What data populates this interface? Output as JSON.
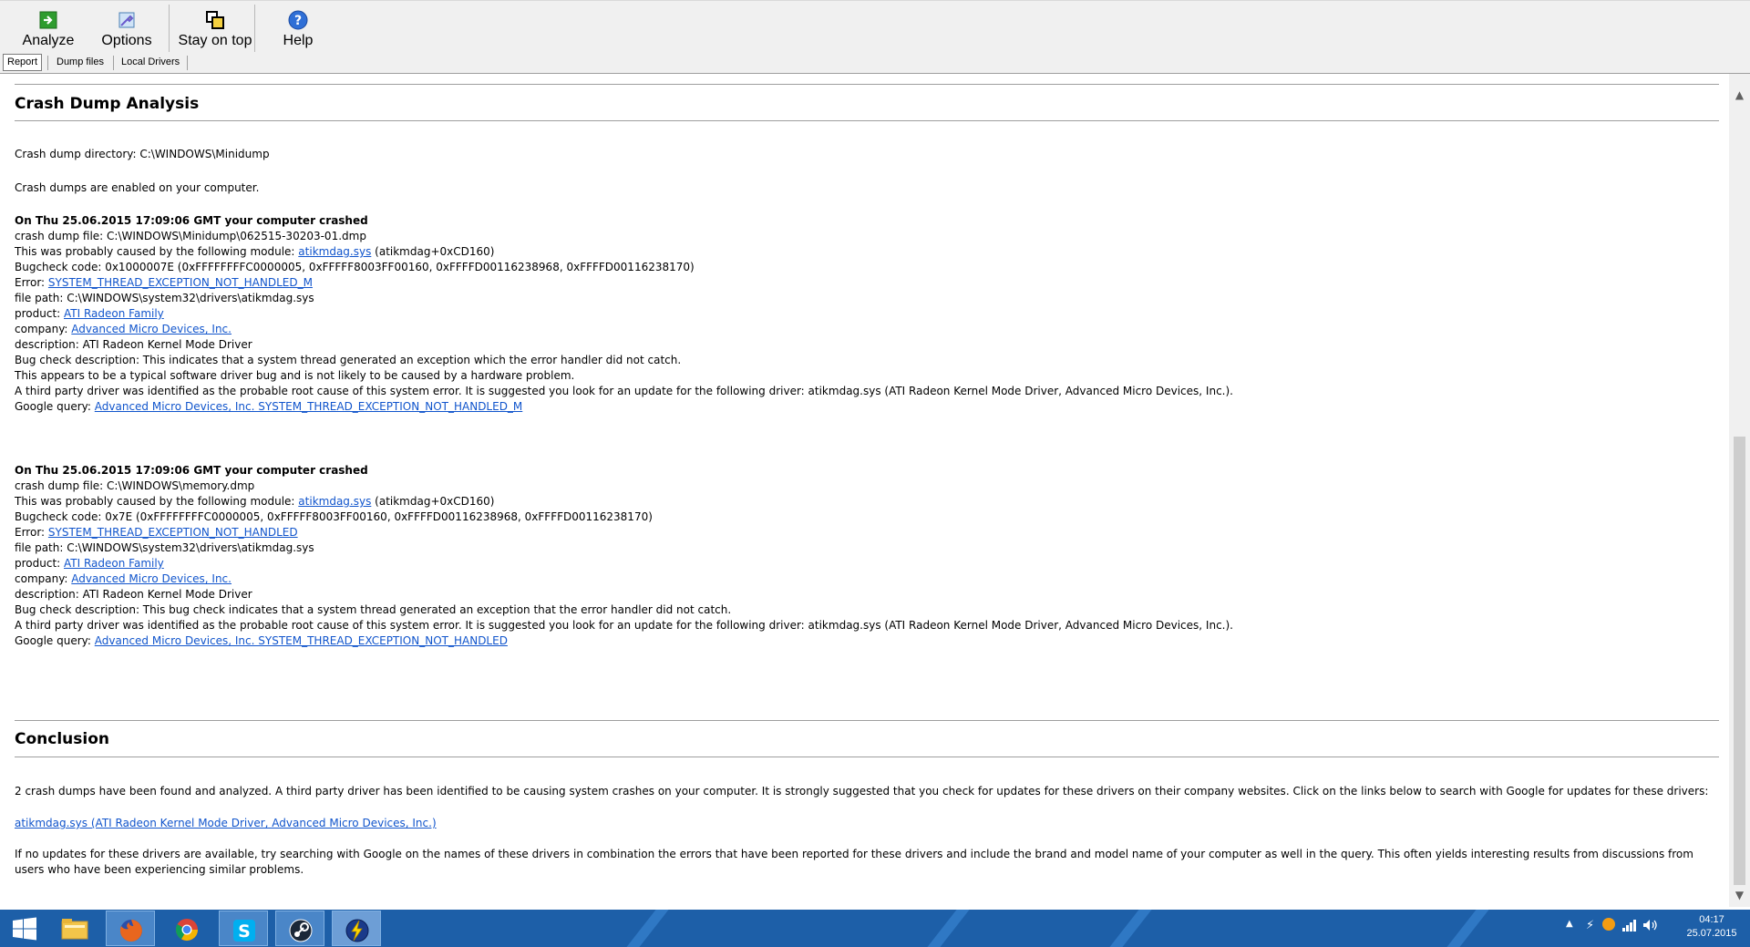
{
  "toolbar": {
    "analyze": "Analyze",
    "options": "Options",
    "stay_on_top": "Stay on top",
    "help": "Help"
  },
  "tabs": [
    "Report",
    "Dump files",
    "Local Drivers"
  ],
  "report": {
    "heading": "Crash Dump Analysis",
    "directory": "Crash dump directory: C:\\WINDOWS\\Minidump",
    "enabled": "Crash dumps are enabled on your computer.",
    "crashes": [
      {
        "title": "On Thu 25.06.2015 17:09:06 GMT your computer crashed",
        "dump_file": "crash dump file: C:\\WINDOWS\\Minidump\\062515-30203-01.dmp",
        "cause_prefix": "This was probably caused by the following module: ",
        "module": "atikmdag.sys",
        "cause_suffix": " (atikmdag+0xCD160)",
        "bugcheck": "Bugcheck code: 0x1000007E (0xFFFFFFFFC0000005, 0xFFFFF8003FF00160, 0xFFFFD00116238968, 0xFFFFD00116238170)",
        "error_prefix": "Error: ",
        "error": "SYSTEM_THREAD_EXCEPTION_NOT_HANDLED_M",
        "file_path": "file path: C:\\WINDOWS\\system32\\drivers\\atikmdag.sys",
        "product_prefix": "product: ",
        "product": "ATI Radeon Family",
        "company_prefix": "company: ",
        "company": "Advanced Micro Devices, Inc.",
        "description": "description: ATI Radeon Kernel Mode Driver",
        "bug_desc": "Bug check description: This indicates that a system thread generated an exception which the error handler did not catch.",
        "note": "This appears to be a typical software driver bug and is not likely to be caused by a hardware problem.",
        "third_party": "A third party driver was identified as the probable root cause of this system error. It is suggested you look for an update for the following driver: atikmdag.sys (ATI Radeon Kernel Mode Driver, Advanced Micro Devices, Inc.).",
        "google_prefix": "Google query: ",
        "google": "Advanced Micro Devices, Inc. SYSTEM_THREAD_EXCEPTION_NOT_HANDLED_M"
      },
      {
        "title": "On Thu 25.06.2015 17:09:06 GMT your computer crashed",
        "dump_file": "crash dump file: C:\\WINDOWS\\memory.dmp",
        "cause_prefix": "This was probably caused by the following module: ",
        "module": "atikmdag.sys",
        "cause_suffix": " (atikmdag+0xCD160)",
        "bugcheck": "Bugcheck code: 0x7E (0xFFFFFFFFC0000005, 0xFFFFF8003FF00160, 0xFFFFD00116238968, 0xFFFFD00116238170)",
        "error_prefix": "Error: ",
        "error": "SYSTEM_THREAD_EXCEPTION_NOT_HANDLED",
        "file_path": "file path: C:\\WINDOWS\\system32\\drivers\\atikmdag.sys",
        "product_prefix": "product: ",
        "product": "ATI Radeon Family",
        "company_prefix": "company: ",
        "company": "Advanced Micro Devices, Inc.",
        "description": "description: ATI Radeon Kernel Mode Driver",
        "bug_desc": "Bug check description: This bug check indicates that a system thread generated an exception that the error handler did not catch.",
        "third_party": "A third party driver was identified as the probable root cause of this system error. It is suggested you look for an update for the following driver: atikmdag.sys (ATI Radeon Kernel Mode Driver, Advanced Micro Devices, Inc.).",
        "google_prefix": "Google query: ",
        "google": "Advanced Micro Devices, Inc. SYSTEM_THREAD_EXCEPTION_NOT_HANDLED"
      }
    ],
    "conclusion_heading": "Conclusion",
    "conclusion_text": "2 crash dumps have been found and analyzed. A third party driver has been identified to be causing system crashes on your computer. It is strongly suggested that you check for updates for these drivers on their company websites. Click on the links below to search with Google for updates for these drivers:",
    "driver_link": "atikmdag.sys (ATI Radeon Kernel Mode Driver, Advanced Micro Devices, Inc.)",
    "final_text": "If no updates for these drivers are available, try searching with Google on the names of these drivers in combination the errors that have been reported for these drivers and include the brand and model name of your computer as well in the query. This often yields interesting results from discussions from users who have been experiencing similar problems."
  },
  "taskbar": {
    "apps": [
      "start-icon",
      "file-explorer-icon",
      "firefox-icon",
      "chrome-icon",
      "skype-icon",
      "steam-icon",
      "bluescreenview-icon"
    ],
    "time": "04:17",
    "date": "25.07.2015"
  },
  "colors": {
    "link": "#1155cc",
    "taskbar": "#1d5fa8"
  }
}
